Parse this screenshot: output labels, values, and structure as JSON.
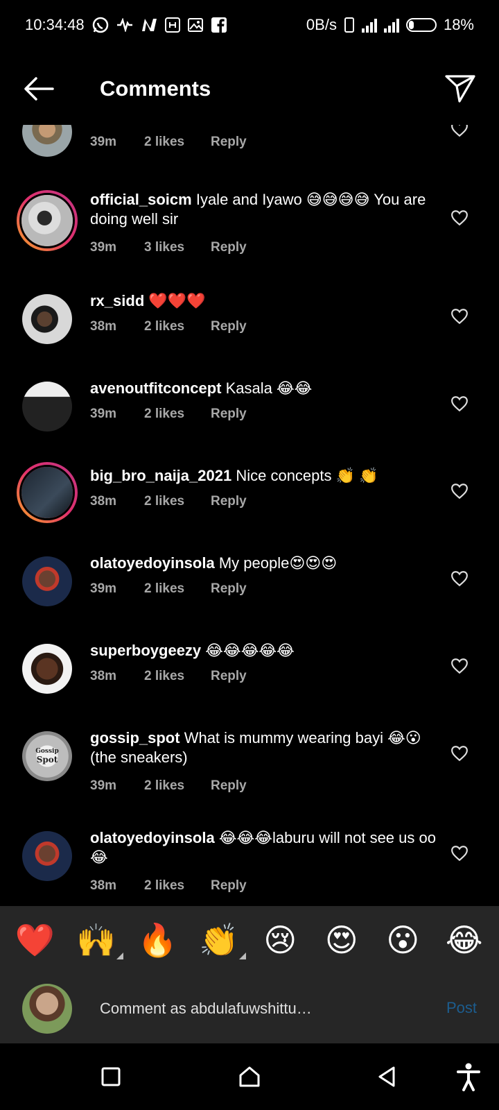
{
  "status_bar": {
    "time": "10:34:48",
    "net_speed": "0B/s",
    "battery_pct": "18%",
    "icons": [
      "whatsapp-icon",
      "audio-icon",
      "n-app-icon",
      "chat-icon",
      "image-icon",
      "facebook-icon"
    ]
  },
  "header": {
    "title": "Comments",
    "back_icon": "back-arrow-icon",
    "send_icon": "send-icon"
  },
  "comments": [
    {
      "username": "",
      "text": "",
      "time": "39m",
      "likes": "2 likes",
      "reply": "Reply"
    },
    {
      "username": "official_soicm",
      "text": " Iyale and Iyawo 😅😅😅😅 You are doing well sir",
      "time": "39m",
      "likes": "3 likes",
      "reply": "Reply"
    },
    {
      "username": "rx_sidd",
      "text": " ❤️❤️❤️",
      "time": "38m",
      "likes": "2 likes",
      "reply": "Reply"
    },
    {
      "username": "avenoutfitconcept",
      "text": " Kasala 😂😂",
      "time": "39m",
      "likes": "2 likes",
      "reply": "Reply"
    },
    {
      "username": "big_bro_naija_2021",
      "text": " Nice concepts 👏 👏",
      "time": "38m",
      "likes": "2 likes",
      "reply": "Reply"
    },
    {
      "username": "olatoyedoyinsola",
      "text": " My people😍😍😍",
      "time": "39m",
      "likes": "2 likes",
      "reply": "Reply"
    },
    {
      "username": "superboygeezy",
      "text": " 😂😂😂😂😂",
      "time": "38m",
      "likes": "2 likes",
      "reply": "Reply"
    },
    {
      "username": "gossip_spot",
      "text": " What is mummy wearing bayi 😂😮 (the sneakers)",
      "time": "39m",
      "likes": "2 likes",
      "reply": "Reply",
      "avatar_text_1": "Gossip",
      "avatar_text_2": "Spot"
    },
    {
      "username": "olatoyedoyinsola",
      "text": " 😂😂😂laburu will not see us oo😂",
      "time": "38m",
      "likes": "2 likes",
      "reply": "Reply"
    }
  ],
  "reactions": [
    "❤️",
    "🙌",
    "🔥",
    "👏",
    "😢",
    "😍",
    "😮",
    "😂"
  ],
  "input": {
    "placeholder": "Comment as abdulafuwshittu…",
    "post_label": "Post"
  },
  "nav": {
    "recent_icon": "recent-apps-icon",
    "home_icon": "home-icon",
    "back_icon": "nav-back-icon",
    "accessibility_icon": "accessibility-icon"
  },
  "colors": {
    "background": "#000000",
    "panel": "#262626",
    "meta_text": "#a8a8a8",
    "post_button": "#1c5d8f",
    "story_ring_start": "#f9a825",
    "story_ring_end": "#c13584"
  }
}
